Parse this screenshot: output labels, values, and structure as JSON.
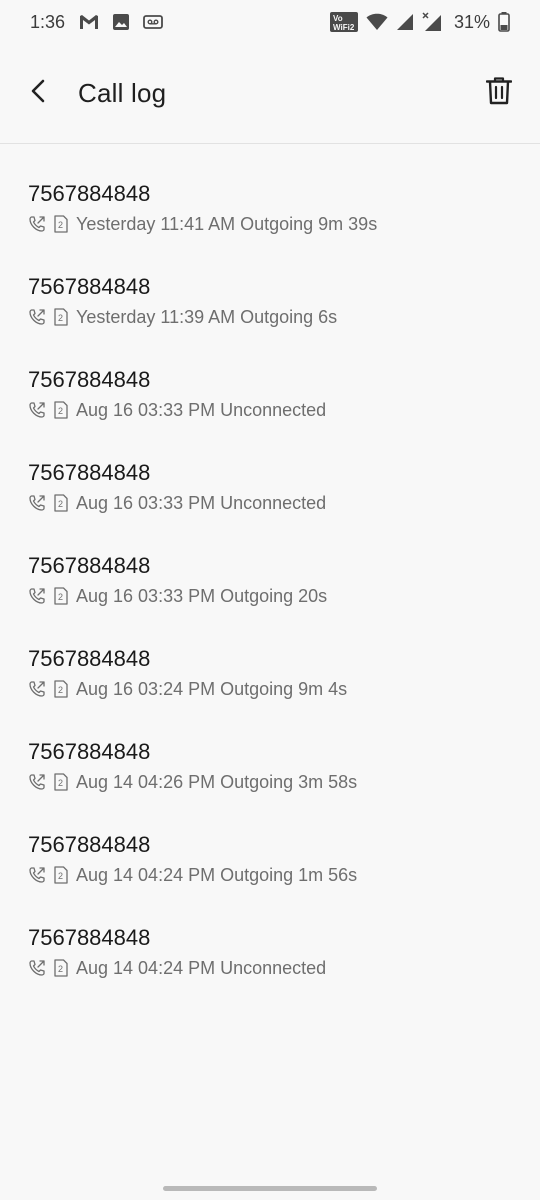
{
  "status_bar": {
    "time": "1:36",
    "battery": "31%",
    "icons": [
      "gmail-icon",
      "gallery-icon",
      "voicemail-icon",
      "volte-wifi-icon",
      "wifi-icon",
      "signal-icon",
      "signal-x-icon",
      "battery-icon"
    ]
  },
  "app_bar": {
    "title": "Call log",
    "back_icon": "back-arrow-icon",
    "action_icon": "trash-icon"
  },
  "calls": [
    {
      "number": "7567884848",
      "details": "Yesterday 11:41 AM Outgoing 9m 39s"
    },
    {
      "number": "7567884848",
      "details": "Yesterday 11:39 AM Outgoing 6s"
    },
    {
      "number": "7567884848",
      "details": "Aug 16 03:33 PM Unconnected"
    },
    {
      "number": "7567884848",
      "details": "Aug 16 03:33 PM Unconnected"
    },
    {
      "number": "7567884848",
      "details": "Aug 16 03:33 PM Outgoing 20s"
    },
    {
      "number": "7567884848",
      "details": "Aug 16 03:24 PM Outgoing 9m 4s"
    },
    {
      "number": "7567884848",
      "details": "Aug 14 04:26 PM Outgoing 3m 58s"
    },
    {
      "number": "7567884848",
      "details": "Aug 14 04:24 PM Outgoing 1m 56s"
    },
    {
      "number": "7567884848",
      "details": "Aug 14 04:24 PM Unconnected"
    }
  ],
  "colors": {
    "background": "#f8f8f8",
    "primary_text": "#1a1a1a",
    "secondary_text": "#6e6e6e"
  }
}
